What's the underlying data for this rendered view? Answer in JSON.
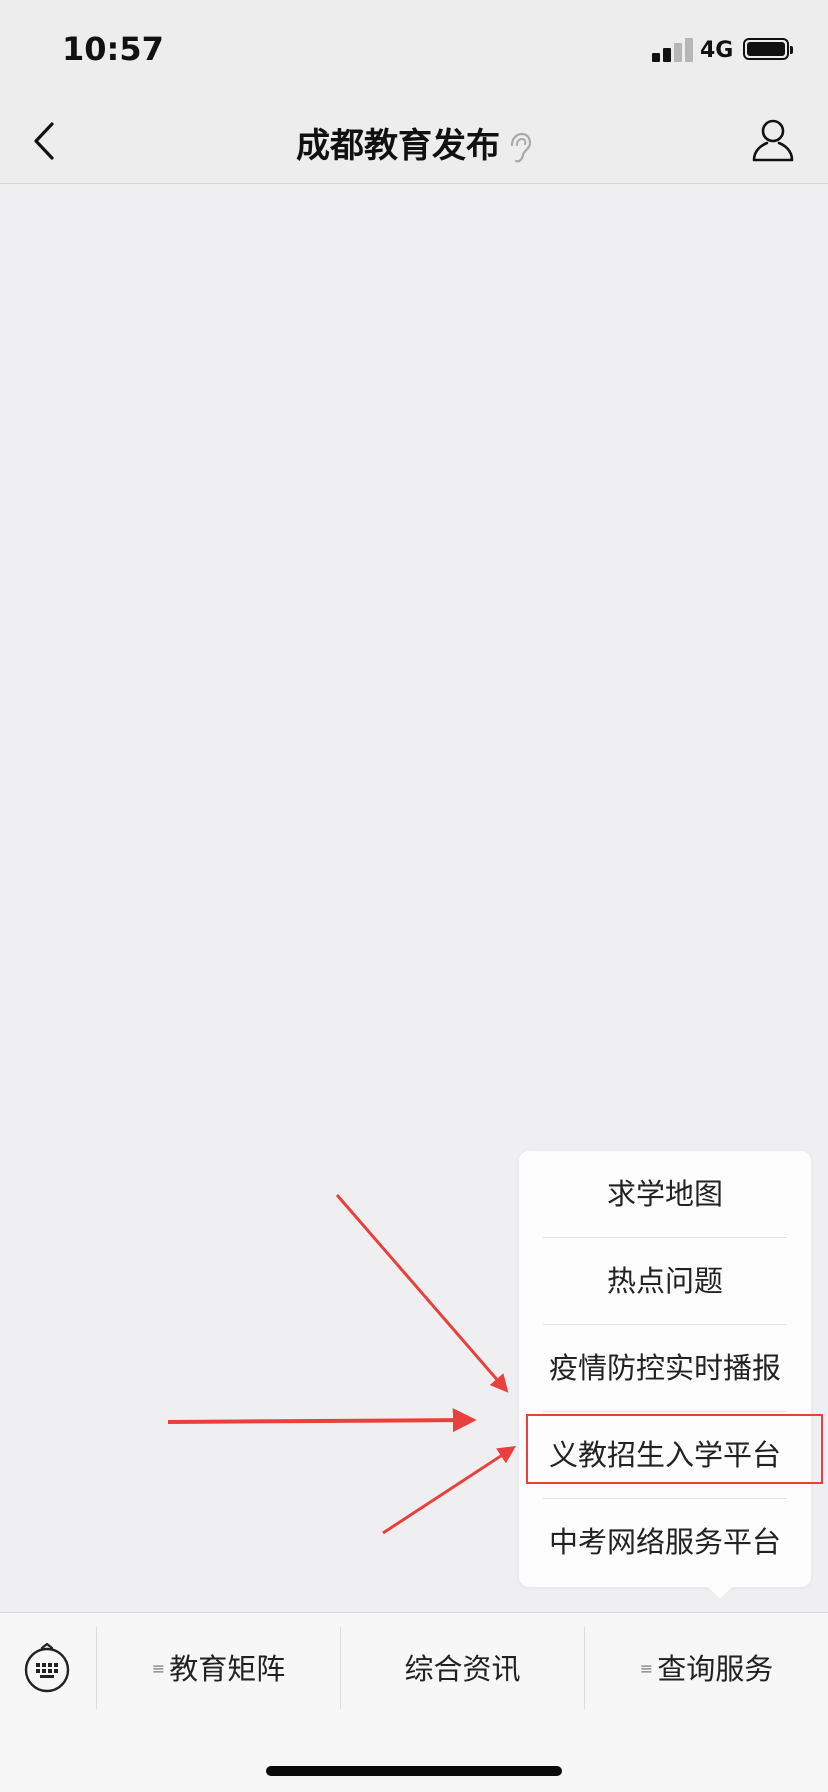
{
  "status_bar": {
    "time": "10:57",
    "network": "4G"
  },
  "nav": {
    "title": "成都教育发布"
  },
  "popup_menu": {
    "items": [
      "求学地图",
      "热点问题",
      "疫情防控实时播报",
      "义教招生入学平台",
      "中考网络服务平台"
    ]
  },
  "tabs": [
    {
      "label": "教育矩阵",
      "has_menu_icon": true
    },
    {
      "label": "综合资讯",
      "has_menu_icon": false
    },
    {
      "label": "查询服务",
      "has_menu_icon": true
    }
  ],
  "icons": {
    "tab_menu": "≡"
  },
  "colors": {
    "annotation": "#e8413d",
    "background": "#efeff1"
  }
}
